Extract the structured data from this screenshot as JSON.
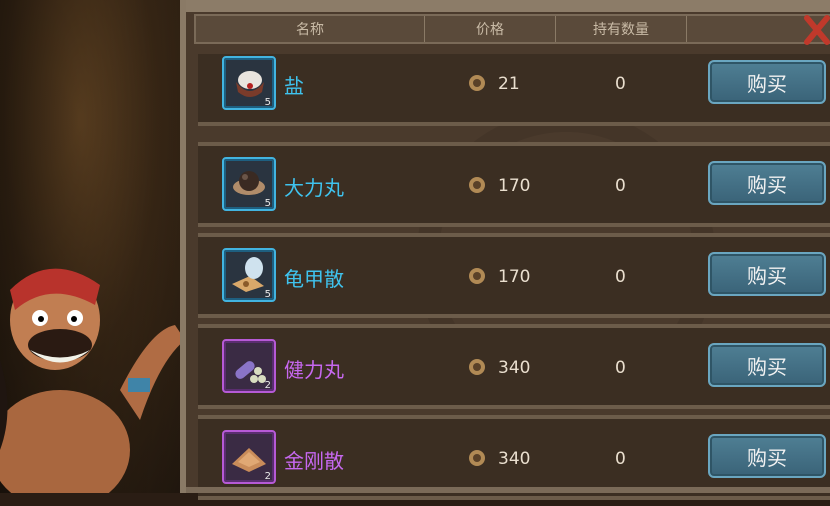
{
  "header": {
    "col_name": "名称",
    "col_price": "价格",
    "col_owned": "持有数量"
  },
  "items": [
    {
      "name": "盐",
      "price": "21",
      "owned": "0",
      "stack": "5",
      "rarity": "blue",
      "icon": "salt-icon"
    },
    {
      "name": "大力丸",
      "price": "170",
      "owned": "0",
      "stack": "5",
      "rarity": "blue",
      "icon": "pill-icon"
    },
    {
      "name": "龟甲散",
      "price": "170",
      "owned": "0",
      "stack": "5",
      "rarity": "blue",
      "icon": "powder-icon"
    },
    {
      "name": "健力丸",
      "price": "340",
      "owned": "0",
      "stack": "2",
      "rarity": "purple",
      "icon": "pills-icon"
    },
    {
      "name": "金刚散",
      "price": "340",
      "owned": "0",
      "stack": "2",
      "rarity": "purple",
      "icon": "powder-pile-icon"
    }
  ],
  "buy_label": "购买",
  "colors": {
    "blue": "#3fc3ee",
    "purple": "#c768f0",
    "button": "#3a6378"
  }
}
